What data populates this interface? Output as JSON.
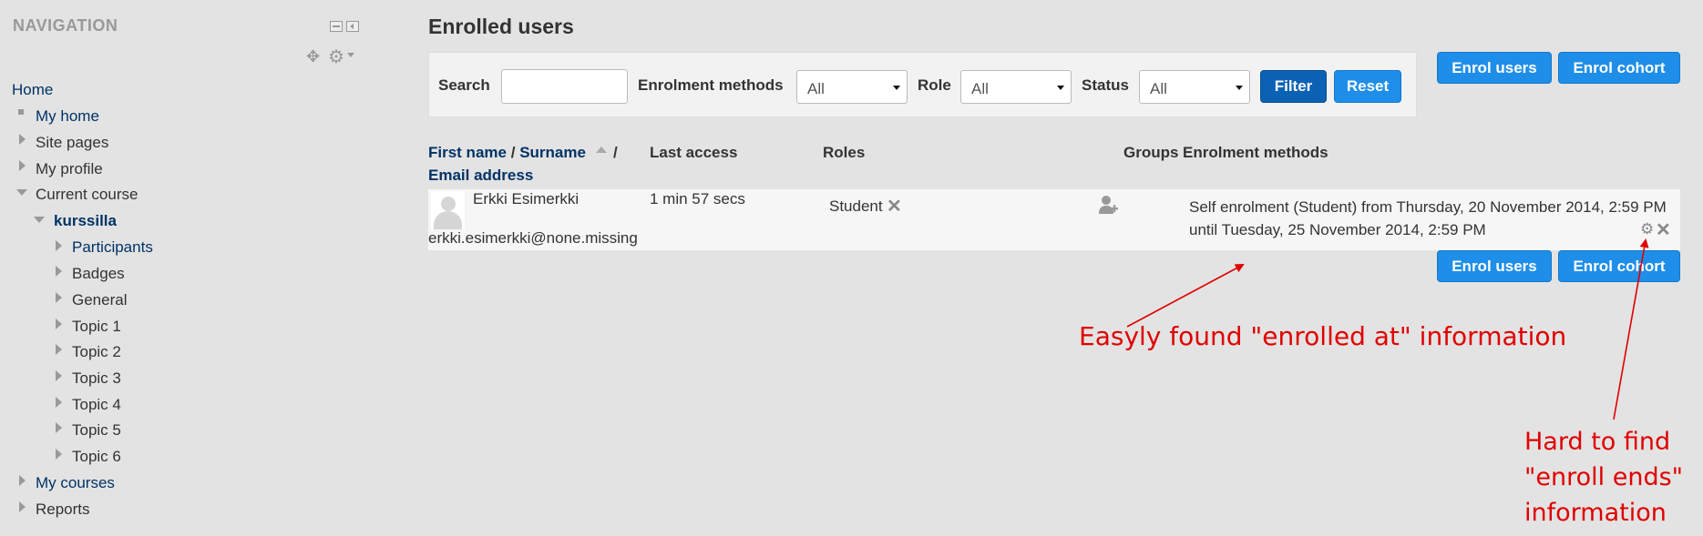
{
  "navigation": {
    "title": "NAVIGATION",
    "items": [
      {
        "label": "Home"
      },
      {
        "label": "My home"
      },
      {
        "label": "Site pages"
      },
      {
        "label": "My profile"
      },
      {
        "label": "Current course"
      },
      {
        "label": "kurssilla"
      },
      {
        "label": "Participants"
      },
      {
        "label": "Badges"
      },
      {
        "label": "General"
      },
      {
        "label": "Topic 1"
      },
      {
        "label": "Topic 2"
      },
      {
        "label": "Topic 3"
      },
      {
        "label": "Topic 4"
      },
      {
        "label": "Topic 5"
      },
      {
        "label": "Topic 6"
      },
      {
        "label": "My courses"
      },
      {
        "label": "Reports"
      }
    ]
  },
  "page": {
    "title": "Enrolled users"
  },
  "filter": {
    "search_label": "Search",
    "search_value": "",
    "enrolment_methods_label": "Enrolment methods",
    "enrolment_methods_value": "All",
    "role_label": "Role",
    "role_value": "All",
    "status_label": "Status",
    "status_value": "All",
    "filter_button": "Filter",
    "reset_button": "Reset"
  },
  "actions": {
    "enrol_users": "Enrol users",
    "enrol_cohort": "Enrol cohort"
  },
  "table": {
    "headers": {
      "first_name": "First name",
      "separator1": "/",
      "surname": "Surname",
      "separator2": "/",
      "email": "Email address",
      "last_access": "Last access",
      "roles": "Roles",
      "groups": "Groups",
      "enrolment_methods": "Enrolment methods"
    },
    "rows": [
      {
        "name": "Erkki Esimerkki",
        "email": "erkki.esimerkki@none.missing",
        "last_access": "1 min 57 secs",
        "role": "Student",
        "enrolment": "Self enrolment (Student) from Thursday, 20 November 2014, 2:59 PM until Tuesday, 25 November 2014, 2:59 PM"
      }
    ]
  },
  "annotations": {
    "easily_found": "Easyly found \"enrolled at\" information",
    "hard_to_find_line1": "Hard to find",
    "hard_to_find_line2": "\"enroll ends\"",
    "hard_to_find_line3": "information"
  },
  "colors": {
    "link": "#003366",
    "button": "#1f8ee9",
    "button_active": "#0b62b5",
    "annotation": "#e00000",
    "background": "#e3e3e3"
  },
  "icons": [
    "move-icon",
    "gear-icon",
    "dock-icon",
    "collapse-icon",
    "sort-asc-icon",
    "unassign-x-icon",
    "add-group-icon",
    "edit-gear-icon",
    "delete-x-icon"
  ]
}
